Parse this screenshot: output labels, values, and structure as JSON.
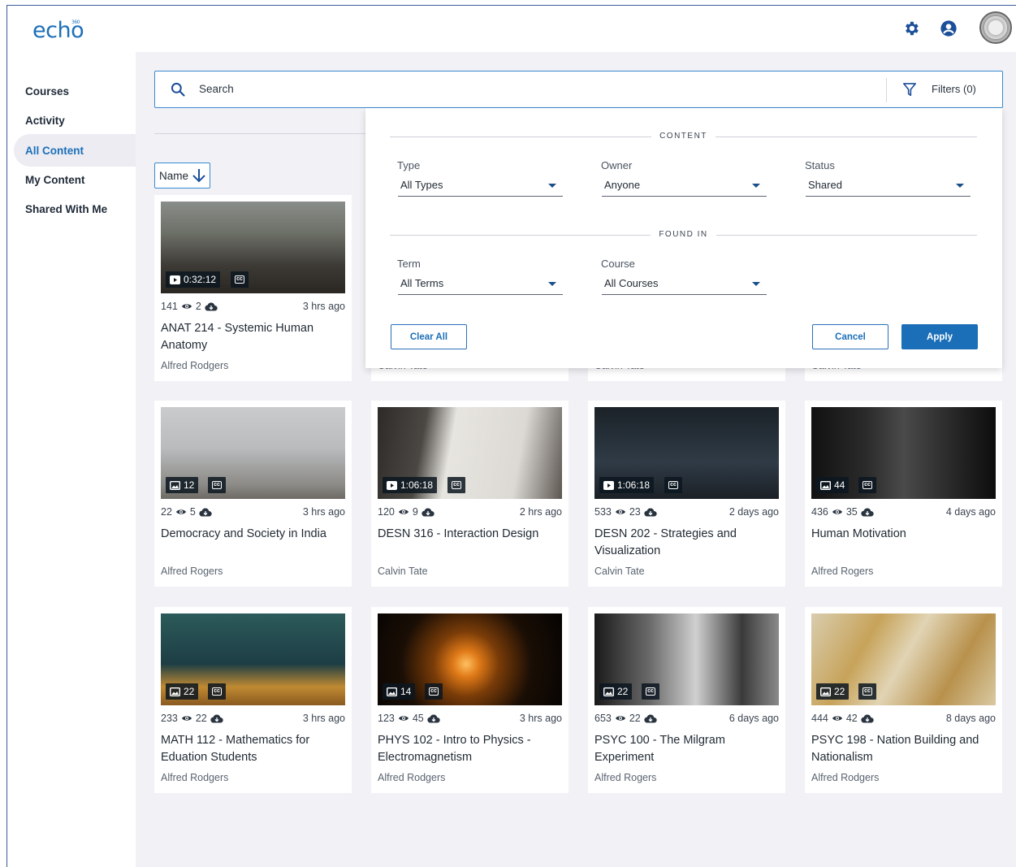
{
  "app": {
    "logo": "echo",
    "logo_mark": "360"
  },
  "header": {
    "icons": [
      "gear-icon",
      "user-icon",
      "institution-seal"
    ]
  },
  "sidebar": {
    "items": [
      {
        "label": "Courses",
        "active": false
      },
      {
        "label": "Activity",
        "active": false
      },
      {
        "label": "All Content",
        "active": true
      },
      {
        "label": "My Content",
        "active": false
      },
      {
        "label": "Shared With Me",
        "active": false
      }
    ]
  },
  "search": {
    "placeholder": "Search",
    "filters_label": "Filters (0)"
  },
  "sort": {
    "label": "Name"
  },
  "filters": {
    "content_heading": "CONTENT",
    "found_in_heading": "FOUND IN",
    "type": {
      "label": "Type",
      "value": "All Types"
    },
    "owner": {
      "label": "Owner",
      "value": "Anyone"
    },
    "status": {
      "label": "Status",
      "value": "Shared"
    },
    "term": {
      "label": "Term",
      "value": "All Terms"
    },
    "course": {
      "label": "Course",
      "value": "All Courses"
    },
    "clear_label": "Clear All",
    "cancel_label": "Cancel",
    "apply_label": "Apply"
  },
  "cards": [
    {
      "badge": "0:32:12",
      "badge_kind": "video",
      "views": "141",
      "downloads": "2",
      "time": "3 hrs ago",
      "title": "ANAT 214 - Systemic Human Anatomy",
      "owner": "Alfred Rodgers"
    },
    {
      "badge": "",
      "badge_kind": "hidden",
      "views": "",
      "downloads": "",
      "time": "",
      "title": "",
      "owner": "Calvin Tate"
    },
    {
      "badge": "",
      "badge_kind": "hidden",
      "views": "",
      "downloads": "",
      "time": "",
      "title": "",
      "owner": "Calvin Tate"
    },
    {
      "badge": "",
      "badge_kind": "hidden",
      "views": "",
      "downloads": "",
      "time": "",
      "title": "",
      "owner": "Calvin Tate"
    },
    {
      "badge": "12",
      "badge_kind": "slides",
      "views": "22",
      "downloads": "5",
      "time": "3 hrs ago",
      "title": "Democracy and Society in India",
      "owner": "Alfred Rogers"
    },
    {
      "badge": "1:06:18",
      "badge_kind": "video",
      "views": "120",
      "downloads": "9",
      "time": "2 hrs ago",
      "title": "DESN 316 - Interaction Design",
      "owner": "Calvin Tate"
    },
    {
      "badge": "1:06:18",
      "badge_kind": "video",
      "views": "533",
      "downloads": "23",
      "time": "2 days ago",
      "title": "DESN 202 - Strategies and Visualization",
      "owner": "Calvin Tate"
    },
    {
      "badge": "44",
      "badge_kind": "slides",
      "views": "436",
      "downloads": "35",
      "time": "4 days ago",
      "title": "Human Motivation",
      "owner": "Alfred Rogers"
    },
    {
      "badge": "22",
      "badge_kind": "slides",
      "views": "233",
      "downloads": "22",
      "time": "3 hrs ago",
      "title": "MATH 112 - Mathematics for Eduation Students",
      "owner": "Alfred Rodgers"
    },
    {
      "badge": "14",
      "badge_kind": "slides",
      "views": "123",
      "downloads": "45",
      "time": "3 hrs ago",
      "title": "PHYS 102 - Intro to Physics - Electromagnetism",
      "owner": "Alfred Rodgers"
    },
    {
      "badge": "22",
      "badge_kind": "slides",
      "views": "653",
      "downloads": "22",
      "time": "6 days ago",
      "title": "PSYC 100 - The Milgram Experiment",
      "owner": "Alfred Rogers"
    },
    {
      "badge": "22",
      "badge_kind": "slides",
      "views": "444",
      "downloads": "42",
      "time": "8 days ago",
      "title": "PSYC 198 - Nation Building and Nationalism",
      "owner": "Alfred Rodgers"
    }
  ],
  "colors": {
    "accent": "#1b6fb8",
    "background": "#f1f1f6"
  }
}
